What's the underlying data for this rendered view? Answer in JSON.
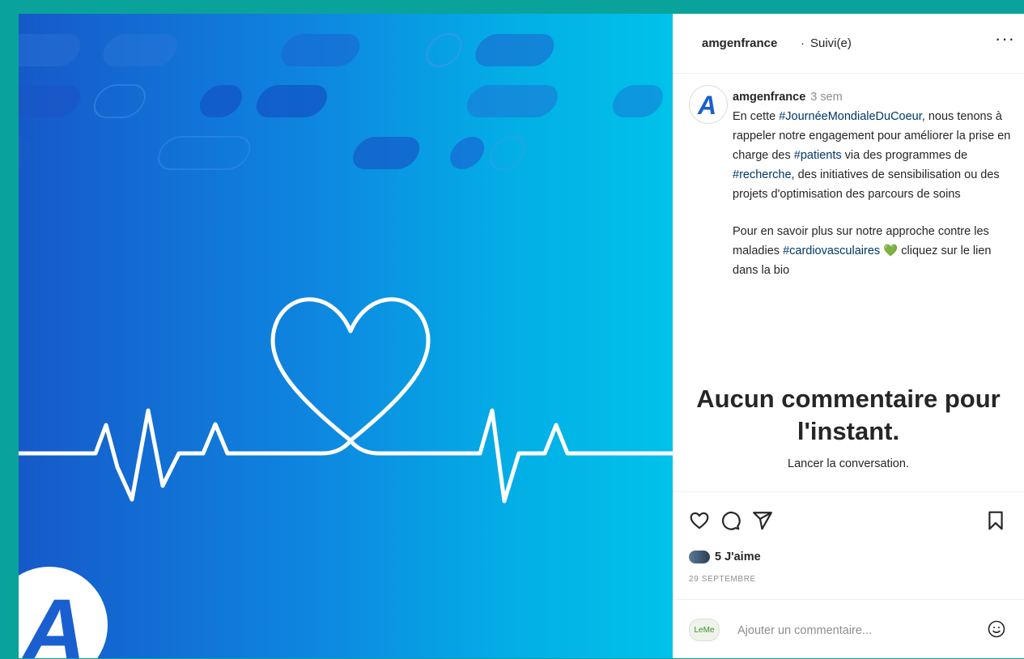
{
  "header": {
    "username": "amgenfrance",
    "separator": "·",
    "follow_status": "Suivi(e)",
    "more_label": "···"
  },
  "post": {
    "image_logo_letter": "A",
    "caption": {
      "username": "amgenfrance",
      "time": "3 sem",
      "p1_a": "En cette ",
      "tag1": "#JournéeMondialeDuCoeur",
      "p1_b": ", nous tenons à rappeler notre engagement pour améliorer la prise en charge des ",
      "tag2": "#patients",
      "p1_c": " via des programmes de ",
      "tag3": "#recherche",
      "p1_d": ", des initiatives de sensibilisation ou des projets d'optimisation des parcours de soins",
      "p2_a": "Pour en savoir plus sur notre approche contre les maladies ",
      "tag4": "#cardiovasculaires",
      "emoji": "💚",
      "p2_b": " cliquez sur le lien dans la bio"
    }
  },
  "comments": {
    "empty_title": "Aucun commentaire pour l'instant.",
    "empty_subtitle": "Lancer la conversation."
  },
  "actions": {
    "icons": [
      "heart-icon",
      "comment-icon",
      "share-icon",
      "bookmark-icon"
    ],
    "likes": "5 J'aime",
    "date": "29 SEPTEMBRE"
  },
  "comment_bar": {
    "avatar_text": "LeMe",
    "placeholder": "Ajouter un commentaire...",
    "emoji_icon": "smiley-icon"
  },
  "colors": {
    "accent_teal": "#0aa39b",
    "hashtag": "#00376b",
    "heart_green": "#3cb043"
  }
}
